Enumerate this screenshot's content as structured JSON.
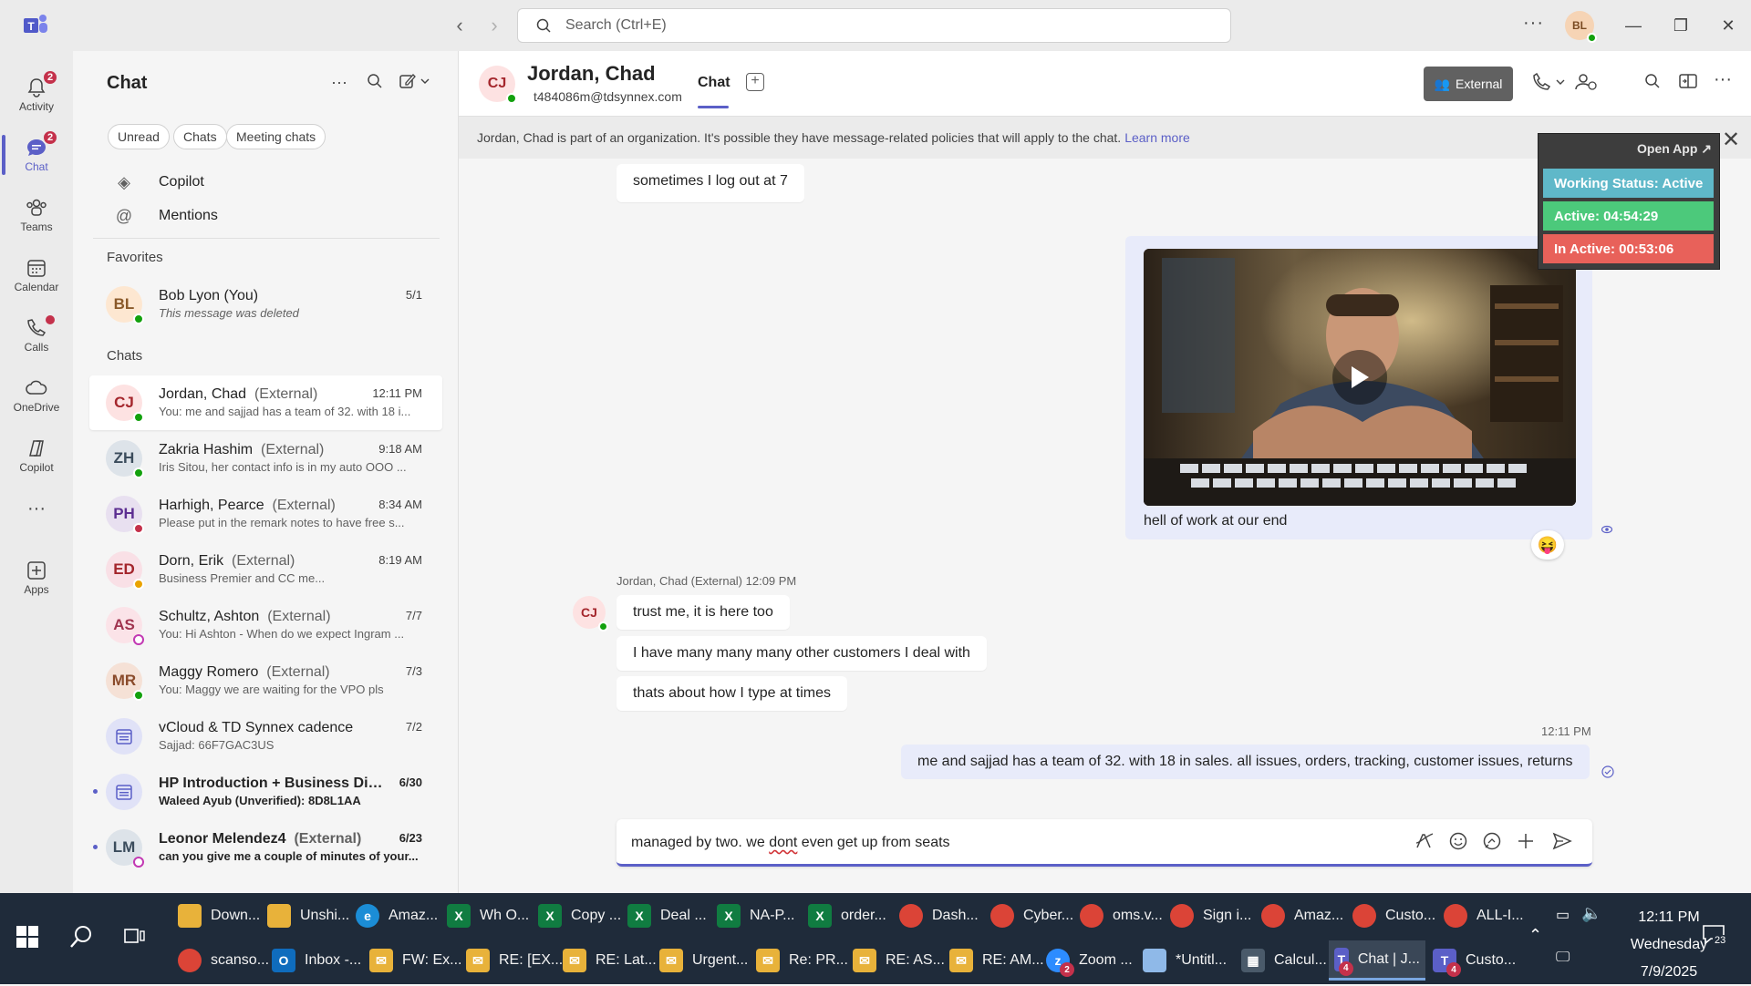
{
  "titlebar": {
    "search_placeholder": "Search (Ctrl+E)",
    "user_initials": "BL",
    "more": "···",
    "back": "‹",
    "forward": "›",
    "minimize": "—",
    "maximize": "❐",
    "close": "✕"
  },
  "rail": {
    "items": [
      {
        "label": "Activity",
        "badge": "2"
      },
      {
        "label": "Chat",
        "badge": "2"
      },
      {
        "label": "Teams"
      },
      {
        "label": "Calendar"
      },
      {
        "label": "Calls"
      },
      {
        "label": "OneDrive"
      },
      {
        "label": "Copilot"
      },
      {
        "label": "Apps"
      }
    ],
    "more": "···"
  },
  "chatlist": {
    "title": "Chat",
    "filters": [
      "Unread",
      "Chats",
      "Meeting chats"
    ],
    "pinned": [
      "Copilot",
      "Mentions"
    ],
    "favorites_label": "Favorites",
    "chats_label": "Chats",
    "favorites": [
      {
        "initials": "BL",
        "name": "Bob Lyon (You)",
        "time": "5/1",
        "preview": "This message was deleted"
      }
    ],
    "chats": [
      {
        "initials": "CJ",
        "name": "Jordan, Chad",
        "ext": "(External)",
        "time": "12:11 PM",
        "preview": "You: me and sajjad has a team of 32. with 18 i..."
      },
      {
        "initials": "ZH",
        "name": "Zakria Hashim",
        "ext": "(External)",
        "time": "9:18 AM",
        "preview": "Iris Sitou, her contact info is in my auto OOO ..."
      },
      {
        "initials": "PH",
        "name": "Harhigh, Pearce",
        "ext": "(External)",
        "time": "8:34 AM",
        "preview": "Please put in the remark notes to have free s..."
      },
      {
        "initials": "ED",
        "name": "Dorn, Erik",
        "ext": "(External)",
        "time": "8:19 AM",
        "preview": "Business Premier and CC me..."
      },
      {
        "initials": "AS",
        "name": "Schultz, Ashton",
        "ext": "(External)",
        "time": "7/7",
        "preview": "You: Hi Ashton -  When do we expect Ingram ..."
      },
      {
        "initials": "MR",
        "name": "Maggy Romero",
        "ext": "(External)",
        "time": "7/3",
        "preview": "You: Maggy we are waiting for the VPO pls"
      },
      {
        "initials": "",
        "name": "vCloud & TD Synnex cadence",
        "ext": "",
        "time": "7/2",
        "preview": "Sajjad: 66F7GAC3US"
      },
      {
        "initials": "",
        "name": "HP Introduction + Business Dis...",
        "ext": "",
        "time": "6/30",
        "preview": "Waleed Ayub (Unverified): 8D8L1AA"
      },
      {
        "initials": "LM",
        "name": "Leonor Melendez4",
        "ext": "(External)",
        "time": "6/23",
        "preview": "can you give me a couple of minutes of your..."
      }
    ]
  },
  "header": {
    "initials": "CJ",
    "name": "Jordan, Chad",
    "email": "t484086m@tdsynnex.com",
    "tab": "Chat",
    "external_label": "External",
    "banner_text": "Jordan, Chad is part of an organization. It's possible they have message-related policies that will apply to the chat.",
    "banner_link": "Learn more"
  },
  "messages": {
    "top_partial": "sometimes I log out at 7",
    "media_caption": "hell of work at our end",
    "reaction": "😝",
    "sender_line": "Jordan, Chad (External)  12:09 PM",
    "sender_initials": "CJ",
    "incoming": [
      "trust me, it is here too",
      "I have many many many other customers I deal with",
      "thats about how I type at times"
    ],
    "out_time": "12:11 PM",
    "outgoing": "me and sajjad has a team of 32. with 18 in sales. all issues, orders, tracking, customer issues, returns"
  },
  "compose": {
    "text_before": "managed by two. we ",
    "misspelled": "dont",
    "text_after": " even get up from seats"
  },
  "widget": {
    "open_app": "Open App ↗",
    "status": "Working Status: Active",
    "active": "Active: 04:54:29",
    "inactive": "In Active: 00:53:06",
    "colors": {
      "status": "#5fb8c9",
      "active": "#4cc97b",
      "inactive": "#e8615a"
    }
  },
  "taskbar": {
    "row1": [
      "Down...",
      "Unshi...",
      "Amaz...",
      "Wh O...",
      "Copy ...",
      "Deal ...",
      "NA-P...",
      "order...",
      "Dash...",
      "Cyber...",
      "oms.v...",
      "Sign i...",
      "Amaz...",
      "Custo...",
      "ALL-I..."
    ],
    "row2": [
      "scanso...",
      "Inbox -...",
      "FW: Ex...",
      "RE: [EX...",
      "RE: Lat...",
      "Urgent...",
      "Re: PR...",
      "RE: AS...",
      "RE: AM...",
      "Zoom ...",
      "*Untitl...",
      "Calcul...",
      "Chat | J...",
      "Custo..."
    ],
    "time": "12:11 PM",
    "day": "Wednesday",
    "date": "7/9/2025",
    "notif_count": "23"
  }
}
